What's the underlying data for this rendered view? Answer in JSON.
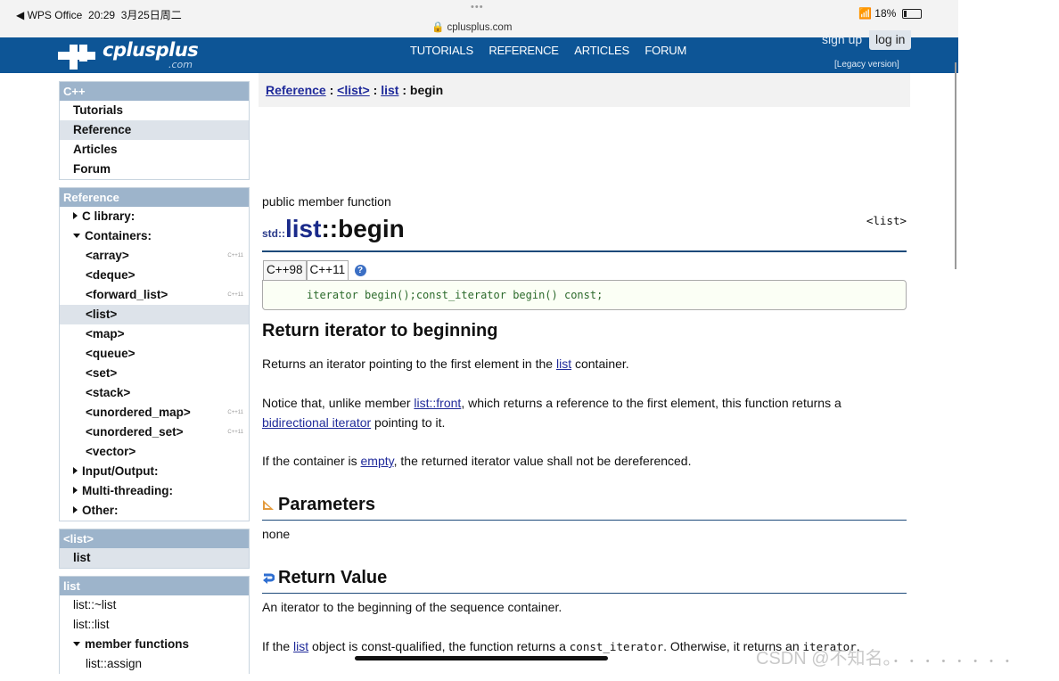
{
  "status_bar": {
    "back_app": "◀ WPS Office",
    "time": "20:29",
    "date": "3月25日周二",
    "dots": "•••",
    "url": "cplusplus.com",
    "battery": "18%"
  },
  "header": {
    "logo_text": "cplusplus",
    "logo_suffix": ".com",
    "nav": [
      "TUTORIALS",
      "REFERENCE",
      "ARTICLES",
      "FORUM"
    ],
    "sign_up": "sign up",
    "log_in": "log in",
    "legacy": "[Legacy version]"
  },
  "sidebar": {
    "cpp_head": "C++",
    "cpp_items": [
      "Tutorials",
      "Reference",
      "Articles",
      "Forum"
    ],
    "ref_head": "Reference",
    "c_library": "C library:",
    "containers": "Containers:",
    "container_items": [
      {
        "label": "<array>",
        "tag": "C++11"
      },
      {
        "label": "<deque>",
        "tag": ""
      },
      {
        "label": "<forward_list>",
        "tag": "C++11"
      },
      {
        "label": "<list>",
        "tag": ""
      },
      {
        "label": "<map>",
        "tag": ""
      },
      {
        "label": "<queue>",
        "tag": ""
      },
      {
        "label": "<set>",
        "tag": ""
      },
      {
        "label": "<stack>",
        "tag": ""
      },
      {
        "label": "<unordered_map>",
        "tag": "C++11"
      },
      {
        "label": "<unordered_set>",
        "tag": "C++11"
      },
      {
        "label": "<vector>",
        "tag": ""
      }
    ],
    "io": "Input/Output:",
    "mt": "Multi-threading:",
    "other": "Other:",
    "list_head": "<list>",
    "list_item": "list",
    "members_head": "list",
    "member_items": [
      "list::~list",
      "list::list"
    ],
    "member_functions": "member functions",
    "member_fn_items": [
      "list::assign"
    ]
  },
  "breadcrumb": {
    "reference": "Reference",
    "sep1": " : ",
    "list_header": "<list>",
    "sep2": " : ",
    "list": "list",
    "sep3": " : ",
    "current": "begin"
  },
  "main": {
    "kind": "public member function",
    "header_tag": "<list>",
    "ns": "std::",
    "title_big": "list",
    "title_rest": "::begin",
    "tabs": [
      "C++98",
      "C++11"
    ],
    "help": "?",
    "code": "iterator begin();const_iterator begin() const;",
    "h_return_iter": "Return iterator to beginning",
    "p1_a": "Returns an iterator pointing to the first element in the ",
    "p1_link": "list",
    "p1_b": " container.",
    "p2_a": "Notice that, unlike member ",
    "p2_link1": "list::front",
    "p2_b": ", which returns a reference to the first element, this function returns a ",
    "p2_link2": "bidirectional iterator",
    "p2_c": " pointing to it.",
    "p3_a": "If the container is ",
    "p3_link": "empty",
    "p3_b": ", the returned iterator value shall not be dereferenced.",
    "h_params": "Parameters",
    "params": "none",
    "h_retval": "Return Value",
    "retval": "An iterator to the beginning of the sequence container.",
    "p4_a": "If the ",
    "p4_link": "list",
    "p4_b": " object is const-qualified, the function returns a ",
    "p4_code1": "const_iterator",
    "p4_c": ". Otherwise, it returns an ",
    "p4_code2": "iterator",
    "p4_d": "."
  },
  "watermark": "CSDN @不知名。",
  "colors": {
    "header_blue": "#0d5596",
    "link": "#1f2a9a",
    "side_head": "#9db4cb"
  }
}
